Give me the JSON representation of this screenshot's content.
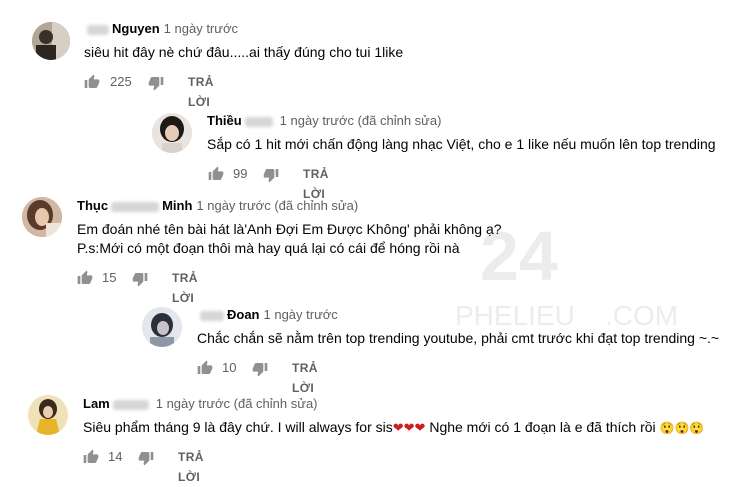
{
  "reply_label": "TRẢ LỜI",
  "watermark": {
    "big": "24",
    "word": "PHELIEU",
    "suffix": ".COM"
  },
  "comments": [
    {
      "author": "Nguyen",
      "time": "1 ngày trước",
      "text": "siêu hit đây nè chứ đâu.....ai thấy đúng cho tui 1like",
      "likes": "225"
    },
    {
      "author": "Thiều",
      "time": "1 ngày trước (đã chỉnh sửa)",
      "text": "Sắp có 1 hit mới chấn động làng nhạc Việt, cho e 1 like nếu muốn lên top trending",
      "likes": "99"
    },
    {
      "author_first": "Thục",
      "author_last": "Minh",
      "time": "1 ngày trước (đã chỉnh sửa)",
      "text_line1": "Em đoán nhé tên bài hát là'Anh Đợi Em Được Không' phải không ạ?",
      "text_line2": "P.s:Mới có một đoạn thôi mà hay quá lại có cái để hóng rồi nà",
      "likes": "15"
    },
    {
      "author": "Đoan",
      "time": "1 ngày trước",
      "text": "Chắc chắn sẽ nằm trên top trending youtube, phải cmt trước khi đạt top trending ~.~",
      "likes": "10"
    },
    {
      "author": "Lam",
      "time": "1 ngày trước (đã chỉnh sửa)",
      "text_before": "Siêu phẩm tháng 9 là đây chứ. I will always for sis",
      "text_hearts": "❤❤❤",
      "text_after": " Nghe mới có 1 đoạn là e đã thích rồi ",
      "text_emoji": "😲😲😲",
      "likes": "14"
    }
  ]
}
